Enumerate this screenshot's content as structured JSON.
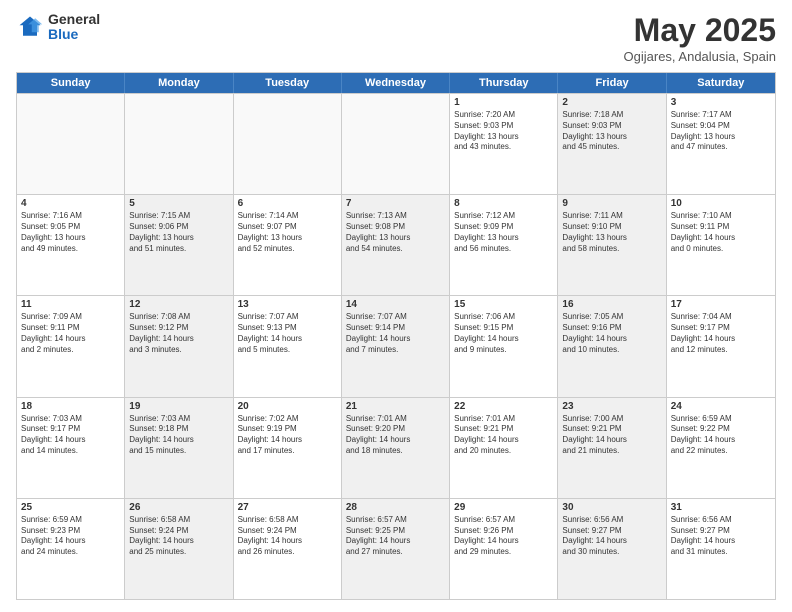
{
  "header": {
    "logo_general": "General",
    "logo_blue": "Blue",
    "title": "May 2025",
    "location": "Ogijares, Andalusia, Spain"
  },
  "days_of_week": [
    "Sunday",
    "Monday",
    "Tuesday",
    "Wednesday",
    "Thursday",
    "Friday",
    "Saturday"
  ],
  "rows": [
    [
      {
        "day": "",
        "text": "",
        "shaded": false,
        "empty": true
      },
      {
        "day": "",
        "text": "",
        "shaded": false,
        "empty": true
      },
      {
        "day": "",
        "text": "",
        "shaded": false,
        "empty": true
      },
      {
        "day": "",
        "text": "",
        "shaded": false,
        "empty": true
      },
      {
        "day": "1",
        "text": "Sunrise: 7:20 AM\nSunset: 9:03 PM\nDaylight: 13 hours\nand 43 minutes.",
        "shaded": false,
        "empty": false
      },
      {
        "day": "2",
        "text": "Sunrise: 7:18 AM\nSunset: 9:03 PM\nDaylight: 13 hours\nand 45 minutes.",
        "shaded": true,
        "empty": false
      },
      {
        "day": "3",
        "text": "Sunrise: 7:17 AM\nSunset: 9:04 PM\nDaylight: 13 hours\nand 47 minutes.",
        "shaded": false,
        "empty": false
      }
    ],
    [
      {
        "day": "4",
        "text": "Sunrise: 7:16 AM\nSunset: 9:05 PM\nDaylight: 13 hours\nand 49 minutes.",
        "shaded": false,
        "empty": false
      },
      {
        "day": "5",
        "text": "Sunrise: 7:15 AM\nSunset: 9:06 PM\nDaylight: 13 hours\nand 51 minutes.",
        "shaded": true,
        "empty": false
      },
      {
        "day": "6",
        "text": "Sunrise: 7:14 AM\nSunset: 9:07 PM\nDaylight: 13 hours\nand 52 minutes.",
        "shaded": false,
        "empty": false
      },
      {
        "day": "7",
        "text": "Sunrise: 7:13 AM\nSunset: 9:08 PM\nDaylight: 13 hours\nand 54 minutes.",
        "shaded": true,
        "empty": false
      },
      {
        "day": "8",
        "text": "Sunrise: 7:12 AM\nSunset: 9:09 PM\nDaylight: 13 hours\nand 56 minutes.",
        "shaded": false,
        "empty": false
      },
      {
        "day": "9",
        "text": "Sunrise: 7:11 AM\nSunset: 9:10 PM\nDaylight: 13 hours\nand 58 minutes.",
        "shaded": true,
        "empty": false
      },
      {
        "day": "10",
        "text": "Sunrise: 7:10 AM\nSunset: 9:11 PM\nDaylight: 14 hours\nand 0 minutes.",
        "shaded": false,
        "empty": false
      }
    ],
    [
      {
        "day": "11",
        "text": "Sunrise: 7:09 AM\nSunset: 9:11 PM\nDaylight: 14 hours\nand 2 minutes.",
        "shaded": false,
        "empty": false
      },
      {
        "day": "12",
        "text": "Sunrise: 7:08 AM\nSunset: 9:12 PM\nDaylight: 14 hours\nand 3 minutes.",
        "shaded": true,
        "empty": false
      },
      {
        "day": "13",
        "text": "Sunrise: 7:07 AM\nSunset: 9:13 PM\nDaylight: 14 hours\nand 5 minutes.",
        "shaded": false,
        "empty": false
      },
      {
        "day": "14",
        "text": "Sunrise: 7:07 AM\nSunset: 9:14 PM\nDaylight: 14 hours\nand 7 minutes.",
        "shaded": true,
        "empty": false
      },
      {
        "day": "15",
        "text": "Sunrise: 7:06 AM\nSunset: 9:15 PM\nDaylight: 14 hours\nand 9 minutes.",
        "shaded": false,
        "empty": false
      },
      {
        "day": "16",
        "text": "Sunrise: 7:05 AM\nSunset: 9:16 PM\nDaylight: 14 hours\nand 10 minutes.",
        "shaded": true,
        "empty": false
      },
      {
        "day": "17",
        "text": "Sunrise: 7:04 AM\nSunset: 9:17 PM\nDaylight: 14 hours\nand 12 minutes.",
        "shaded": false,
        "empty": false
      }
    ],
    [
      {
        "day": "18",
        "text": "Sunrise: 7:03 AM\nSunset: 9:17 PM\nDaylight: 14 hours\nand 14 minutes.",
        "shaded": false,
        "empty": false
      },
      {
        "day": "19",
        "text": "Sunrise: 7:03 AM\nSunset: 9:18 PM\nDaylight: 14 hours\nand 15 minutes.",
        "shaded": true,
        "empty": false
      },
      {
        "day": "20",
        "text": "Sunrise: 7:02 AM\nSunset: 9:19 PM\nDaylight: 14 hours\nand 17 minutes.",
        "shaded": false,
        "empty": false
      },
      {
        "day": "21",
        "text": "Sunrise: 7:01 AM\nSunset: 9:20 PM\nDaylight: 14 hours\nand 18 minutes.",
        "shaded": true,
        "empty": false
      },
      {
        "day": "22",
        "text": "Sunrise: 7:01 AM\nSunset: 9:21 PM\nDaylight: 14 hours\nand 20 minutes.",
        "shaded": false,
        "empty": false
      },
      {
        "day": "23",
        "text": "Sunrise: 7:00 AM\nSunset: 9:21 PM\nDaylight: 14 hours\nand 21 minutes.",
        "shaded": true,
        "empty": false
      },
      {
        "day": "24",
        "text": "Sunrise: 6:59 AM\nSunset: 9:22 PM\nDaylight: 14 hours\nand 22 minutes.",
        "shaded": false,
        "empty": false
      }
    ],
    [
      {
        "day": "25",
        "text": "Sunrise: 6:59 AM\nSunset: 9:23 PM\nDaylight: 14 hours\nand 24 minutes.",
        "shaded": false,
        "empty": false
      },
      {
        "day": "26",
        "text": "Sunrise: 6:58 AM\nSunset: 9:24 PM\nDaylight: 14 hours\nand 25 minutes.",
        "shaded": true,
        "empty": false
      },
      {
        "day": "27",
        "text": "Sunrise: 6:58 AM\nSunset: 9:24 PM\nDaylight: 14 hours\nand 26 minutes.",
        "shaded": false,
        "empty": false
      },
      {
        "day": "28",
        "text": "Sunrise: 6:57 AM\nSunset: 9:25 PM\nDaylight: 14 hours\nand 27 minutes.",
        "shaded": true,
        "empty": false
      },
      {
        "day": "29",
        "text": "Sunrise: 6:57 AM\nSunset: 9:26 PM\nDaylight: 14 hours\nand 29 minutes.",
        "shaded": false,
        "empty": false
      },
      {
        "day": "30",
        "text": "Sunrise: 6:56 AM\nSunset: 9:27 PM\nDaylight: 14 hours\nand 30 minutes.",
        "shaded": true,
        "empty": false
      },
      {
        "day": "31",
        "text": "Sunrise: 6:56 AM\nSunset: 9:27 PM\nDaylight: 14 hours\nand 31 minutes.",
        "shaded": false,
        "empty": false
      }
    ]
  ]
}
